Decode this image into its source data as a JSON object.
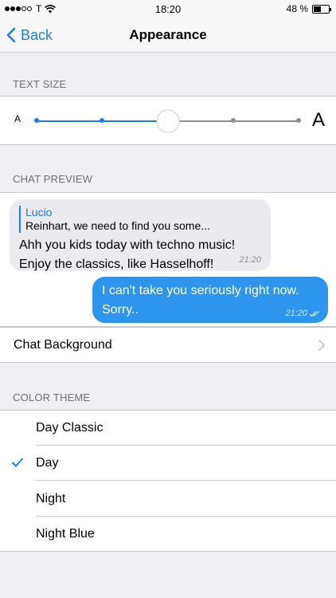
{
  "status_bar": {
    "carrier": "T",
    "time": "18:20",
    "battery": "48 %",
    "battery_level": 0.48
  },
  "nav": {
    "back_label": "Back",
    "title": "Appearance"
  },
  "text_size": {
    "header": "TEXT SIZE",
    "small_label": "A",
    "large_label": "A",
    "steps": 7,
    "selected_step": 3
  },
  "chat_preview": {
    "header": "CHAT PREVIEW",
    "incoming": {
      "reply_name": "Lucio",
      "reply_text": "Reinhart, we need to find you some...",
      "text_line1": "Ahh you kids today with techno music!",
      "text_line2": "Enjoy the classics, like Hasselhoff!",
      "time": "21:20"
    },
    "outgoing": {
      "text_line1": "I can't take you seriously right now.",
      "text_line2": "Sorry..",
      "time": "21:20"
    }
  },
  "chat_background": {
    "label": "Chat Background"
  },
  "color_theme": {
    "header": "COLOR THEME",
    "options": [
      "Day Classic",
      "Day",
      "Night",
      "Night Blue"
    ],
    "selected": "Day"
  },
  "colors": {
    "accent": "#1a7fe0",
    "outgoing_bubble": "#2d95ec",
    "incoming_bubble": "#eaeaef",
    "background": "#efeff4"
  }
}
